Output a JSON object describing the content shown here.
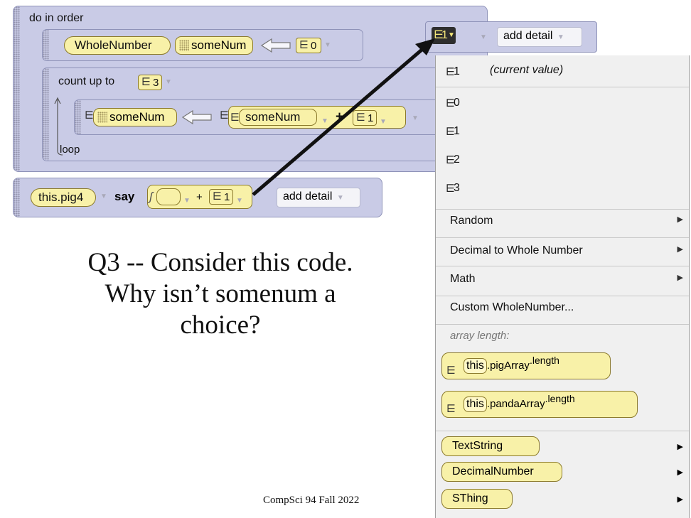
{
  "editor": {
    "do_in_order_label": "do in order",
    "decl": {
      "type": "WholeNumber",
      "var": "someNum",
      "init_value": "0"
    },
    "count_loop": {
      "label": "count up to",
      "count": "3",
      "loop_label": "loop",
      "assign_var": "someNum",
      "expr_var": "someNum",
      "expr_op": "+",
      "expr_value": "1"
    },
    "say_stmt": {
      "target": "this.pig4",
      "verb": "say",
      "op": "+",
      "value": "1",
      "detail": "add detail"
    }
  },
  "menu_header": {
    "current_value": "1",
    "detail": "add detail"
  },
  "menu": {
    "current_item": {
      "value": "1",
      "label": "(current value)"
    },
    "values": [
      "0",
      "1",
      "2",
      "3"
    ],
    "submenus": [
      "Random",
      "Decimal to Whole Number",
      "Math"
    ],
    "custom": "Custom WholeNumber...",
    "array_length_label": "array length:",
    "array_items": [
      {
        "this": "this",
        "field": ".pigArray",
        "prop": ".length"
      },
      {
        "this": "this",
        "field": ".pandaArray",
        "prop": ".length"
      }
    ],
    "type_items": [
      "TextString",
      "DecimalNumber",
      "SThing"
    ]
  },
  "slide": {
    "question_lines": [
      "Q3 -- Consider this code.",
      "Why isn’t somenum a",
      "choice?"
    ],
    "footer": "CompSci 94 Fall 2022"
  },
  "colors": {
    "block_bg": "#c9cbe6",
    "tile_bg": "#f8f1a8",
    "menu_bg": "#f0f0f0",
    "arrow": "#111111"
  }
}
